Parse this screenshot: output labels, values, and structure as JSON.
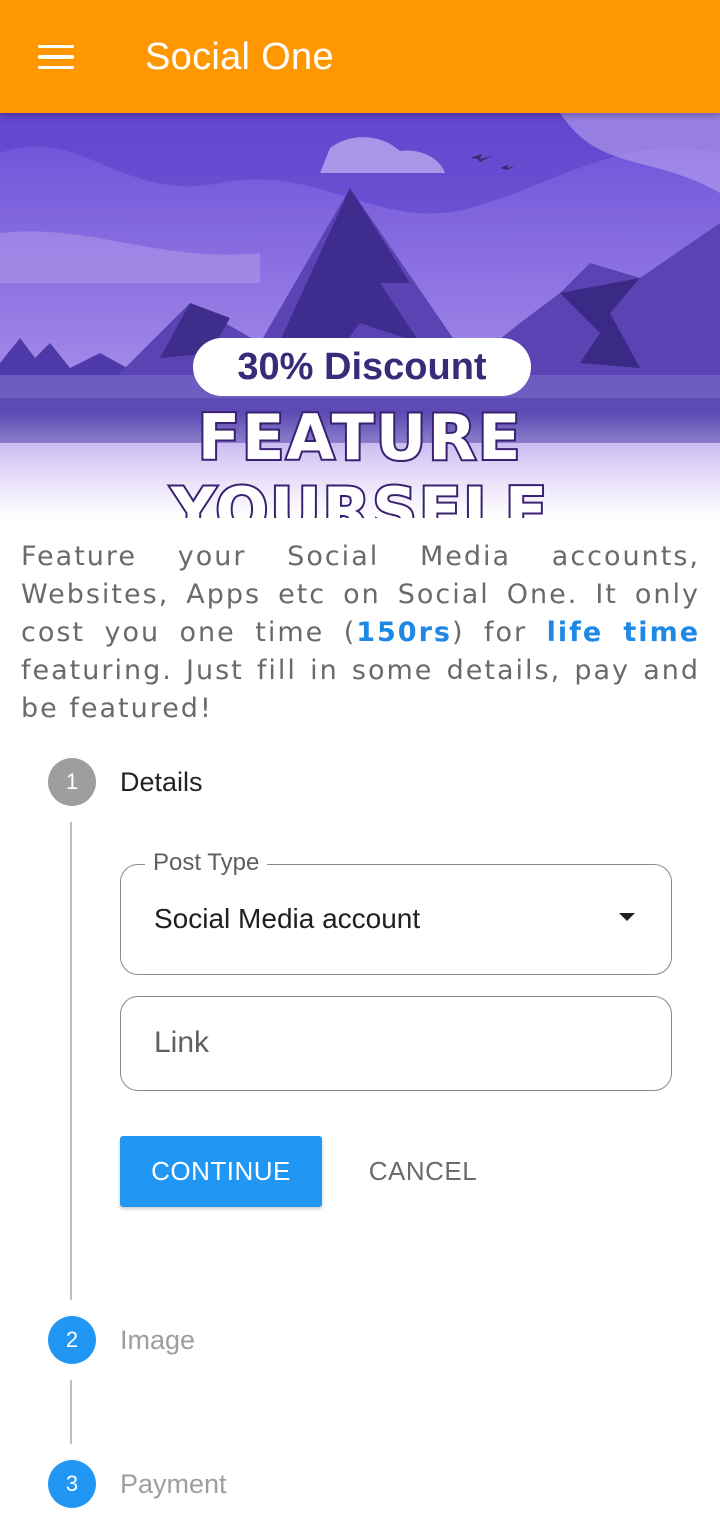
{
  "appbar": {
    "title": "Social One",
    "menu_icon": "hamburger-menu-icon",
    "color": "#ff9800"
  },
  "banner": {
    "discount": "30% Discount",
    "headline": "FEATURE YOURSELF"
  },
  "description": {
    "part1": "Feature your Social Media accounts, Websites, Apps etc on Social One. It only cost you one time (",
    "price": "150rs",
    "part2": ") for ",
    "duration": "life time",
    "part3": " featuring. Just fill in some details, pay and be featured!"
  },
  "steps": [
    {
      "number": "1",
      "label": "Details",
      "state": "active"
    },
    {
      "number": "2",
      "label": "Image",
      "state": "pending"
    },
    {
      "number": "3",
      "label": "Payment",
      "state": "pending"
    }
  ],
  "form": {
    "post_type_label": "Post Type",
    "post_type_value": "Social Media account",
    "link_placeholder": "Link",
    "continue_label": "CONTINUE",
    "cancel_label": "CANCEL"
  },
  "colors": {
    "accent": "#2196f3",
    "link": "#1e88e5",
    "inactive_step": "#9e9e9e"
  }
}
